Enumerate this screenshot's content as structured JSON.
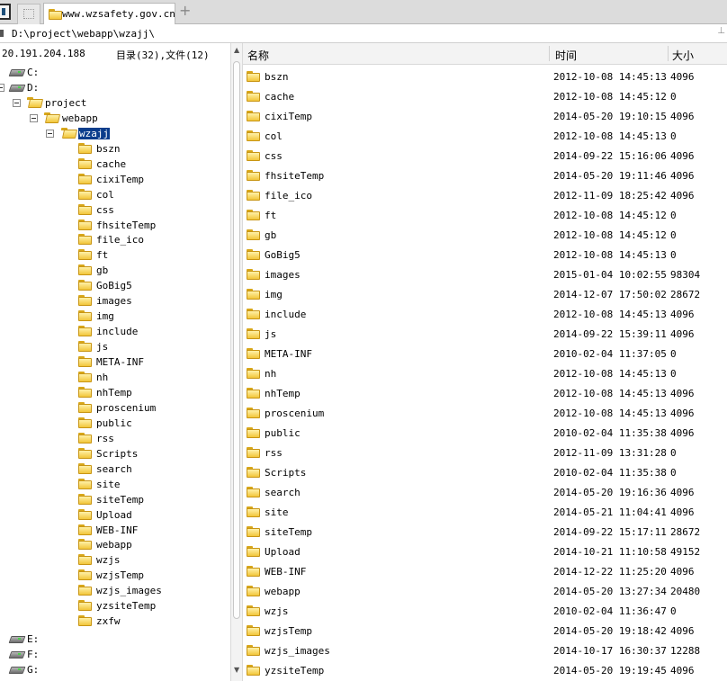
{
  "tabs": {
    "active_title": "www.wzsafety.gov.cn",
    "new_tab_label": "+"
  },
  "address": {
    "path": "D:\\project\\webapp\\wzajj\\"
  },
  "status": {
    "ip": "20.191.204.188",
    "counts": "目录(32),文件(12)"
  },
  "tree": {
    "drives_top": [
      "C:",
      "D:"
    ],
    "project": "project",
    "webapp": "webapp",
    "selected": "wzajj",
    "children": [
      "bszn",
      "cache",
      "cixiTemp",
      "col",
      "css",
      "fhsiteTemp",
      "file_ico",
      "ft",
      "gb",
      "GoBig5",
      "images",
      "img",
      "include",
      "js",
      "META-INF",
      "nh",
      "nhTemp",
      "proscenium",
      "public",
      "rss",
      "Scripts",
      "search",
      "site",
      "siteTemp",
      "Upload",
      "WEB-INF",
      "webapp",
      "wzjs",
      "wzjsTemp",
      "wzjs_images",
      "yzsiteTemp",
      "zxfw"
    ],
    "drives_bottom": [
      "E:",
      "F:",
      "G:"
    ]
  },
  "table": {
    "headers": {
      "name": "名称",
      "time": "时间",
      "size": "大小"
    },
    "rows": [
      {
        "name": "bszn",
        "time": "2012-10-08 14:45:13",
        "size": "4096"
      },
      {
        "name": "cache",
        "time": "2012-10-08 14:45:12",
        "size": "0"
      },
      {
        "name": "cixiTemp",
        "time": "2014-05-20 19:10:15",
        "size": "4096"
      },
      {
        "name": "col",
        "time": "2012-10-08 14:45:13",
        "size": "0"
      },
      {
        "name": "css",
        "time": "2014-09-22 15:16:06",
        "size": "4096"
      },
      {
        "name": "fhsiteTemp",
        "time": "2014-05-20 19:11:46",
        "size": "4096"
      },
      {
        "name": "file_ico",
        "time": "2012-11-09 18:25:42",
        "size": "4096"
      },
      {
        "name": "ft",
        "time": "2012-10-08 14:45:12",
        "size": "0"
      },
      {
        "name": "gb",
        "time": "2012-10-08 14:45:12",
        "size": "0"
      },
      {
        "name": "GoBig5",
        "time": "2012-10-08 14:45:13",
        "size": "0"
      },
      {
        "name": "images",
        "time": "2015-01-04 10:02:55",
        "size": "98304"
      },
      {
        "name": "img",
        "time": "2014-12-07 17:50:02",
        "size": "28672"
      },
      {
        "name": "include",
        "time": "2012-10-08 14:45:13",
        "size": "4096"
      },
      {
        "name": "js",
        "time": "2014-09-22 15:39:11",
        "size": "4096"
      },
      {
        "name": "META-INF",
        "time": "2010-02-04 11:37:05",
        "size": "0"
      },
      {
        "name": "nh",
        "time": "2012-10-08 14:45:13",
        "size": "0"
      },
      {
        "name": "nhTemp",
        "time": "2012-10-08 14:45:13",
        "size": "4096"
      },
      {
        "name": "proscenium",
        "time": "2012-10-08 14:45:13",
        "size": "4096"
      },
      {
        "name": "public",
        "time": "2010-02-04 11:35:38",
        "size": "4096"
      },
      {
        "name": "rss",
        "time": "2012-11-09 13:31:28",
        "size": "0"
      },
      {
        "name": "Scripts",
        "time": "2010-02-04 11:35:38",
        "size": "0"
      },
      {
        "name": "search",
        "time": "2014-05-20 19:16:36",
        "size": "4096"
      },
      {
        "name": "site",
        "time": "2014-05-21 11:04:41",
        "size": "4096"
      },
      {
        "name": "siteTemp",
        "time": "2014-09-22 15:17:11",
        "size": "28672"
      },
      {
        "name": "Upload",
        "time": "2014-10-21 11:10:58",
        "size": "49152"
      },
      {
        "name": "WEB-INF",
        "time": "2014-12-22 11:25:20",
        "size": "4096"
      },
      {
        "name": "webapp",
        "time": "2014-05-20 13:27:34",
        "size": "20480"
      },
      {
        "name": "wzjs",
        "time": "2010-02-04 11:36:47",
        "size": "0"
      },
      {
        "name": "wzjsTemp",
        "time": "2014-05-20 19:18:42",
        "size": "4096"
      },
      {
        "name": "wzjs_images",
        "time": "2014-10-17 16:30:37",
        "size": "12288"
      },
      {
        "name": "yzsiteTemp",
        "time": "2014-05-20 19:19:45",
        "size": "4096"
      }
    ]
  },
  "icons": {
    "folder": "folder-icon",
    "drive": "drive-icon",
    "expander": "minus-box-icon"
  },
  "colors": {
    "selection": "#0b3d8c",
    "folder": "#f2c63a"
  }
}
